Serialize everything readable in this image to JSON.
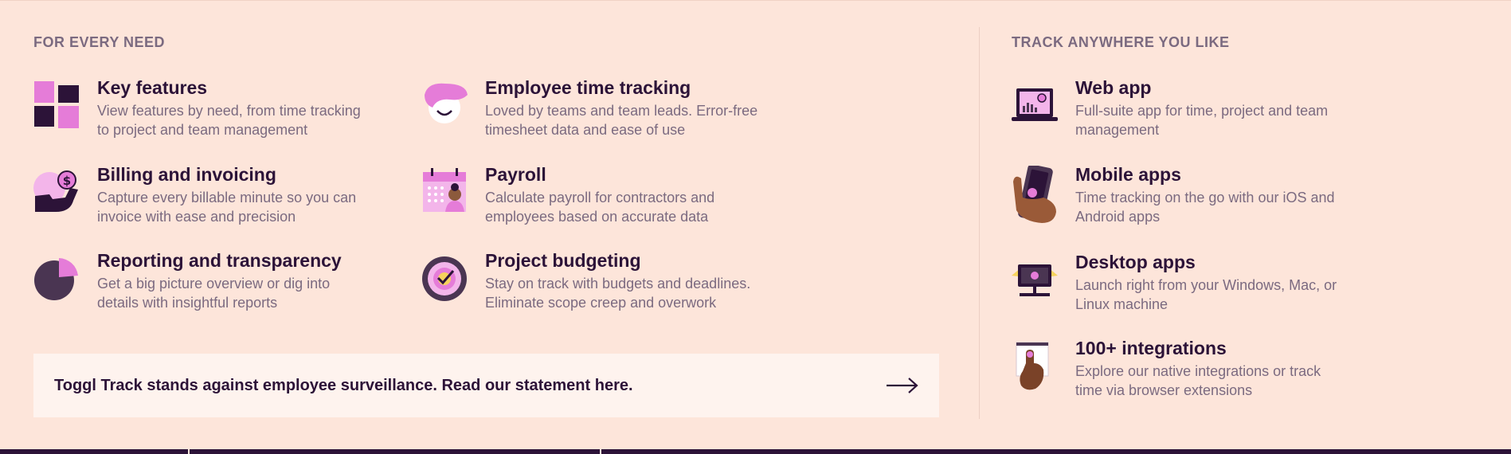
{
  "left_heading": "FOR EVERY NEED",
  "right_heading": "TRACK ANYWHERE YOU LIKE",
  "features": [
    {
      "title": "Key features",
      "desc1": "View features by need, from time tracking",
      "desc2": "to project and team management",
      "icon": "grid-squares-icon"
    },
    {
      "title": "Employee time tracking",
      "desc1": "Loved by teams and team leads. Error-free",
      "desc2": "timesheet data and ease of use",
      "icon": "smiling-person-icon"
    },
    {
      "title": "Billing and invoicing",
      "desc1": "Capture every billable minute so you can",
      "desc2": "invoice with ease and precision",
      "icon": "hand-coin-icon"
    },
    {
      "title": "Payroll",
      "desc1": "Calculate payroll for contractors and",
      "desc2": "employees based on accurate data",
      "icon": "calendar-person-icon"
    },
    {
      "title": "Reporting and transparency",
      "desc1": "Get a big picture overview or dig into",
      "desc2": "details with insightful reports",
      "icon": "pie-chart-icon"
    },
    {
      "title": "Project budgeting",
      "desc1": "Stay on track with budgets and deadlines.",
      "desc2": "Eliminate scope creep and overwork",
      "icon": "target-check-icon"
    }
  ],
  "platforms": [
    {
      "title": "Web app",
      "desc1": "Full-suite app for time, project and team",
      "desc2": "management",
      "icon": "laptop-icon"
    },
    {
      "title": "Mobile apps",
      "desc1": "Time tracking on the go with our iOS and",
      "desc2": "Android apps",
      "icon": "phone-in-hand-icon"
    },
    {
      "title": "Desktop apps",
      "desc1": "Launch right from your Windows, Mac, or",
      "desc2": "Linux machine",
      "icon": "desktop-monitor-icon"
    },
    {
      "title": "100+ integrations",
      "desc1": "Explore our native integrations or track",
      "desc2": "time via browser extensions",
      "icon": "browser-click-icon"
    }
  ],
  "banner": {
    "text": "Toggl Track stands against employee surveillance. Read our statement here.",
    "icon": "arrow-right-icon"
  },
  "colors": {
    "background": "#fde5da",
    "primary": "#2c1338",
    "accent": "#e57cd8",
    "muted": "#7b6a80",
    "banner_bg": "#fef3ee"
  }
}
